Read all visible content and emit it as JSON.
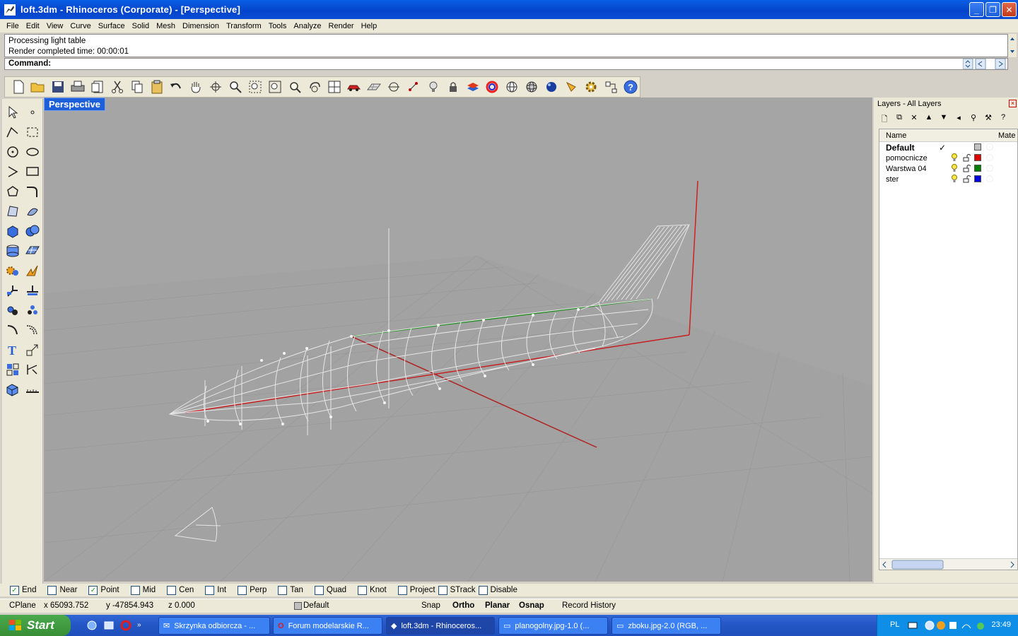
{
  "window": {
    "title": "loft.3dm - Rhinoceros (Corporate) - [Perspective]"
  },
  "menu": [
    "File",
    "Edit",
    "View",
    "Curve",
    "Surface",
    "Solid",
    "Mesh",
    "Dimension",
    "Transform",
    "Tools",
    "Analyze",
    "Render",
    "Help"
  ],
  "command_history": [
    "Processing light table",
    "Render completed time: 00:00:01"
  ],
  "command_prompt": "Command:",
  "viewport": {
    "label": "Perspective"
  },
  "layers_panel": {
    "title": "Layers - All Layers",
    "columns": {
      "name": "Name",
      "material": "Mate"
    },
    "layers": [
      {
        "name": "Default",
        "current": true,
        "color": "#c0c0c0"
      },
      {
        "name": "pomocnicze",
        "current": false,
        "color": "#e00000"
      },
      {
        "name": "Warstwa 04",
        "current": false,
        "color": "#008000"
      },
      {
        "name": "ster",
        "current": false,
        "color": "#0000e0"
      }
    ]
  },
  "osnap": [
    {
      "label": "End",
      "checked": true
    },
    {
      "label": "Near",
      "checked": false
    },
    {
      "label": "Point",
      "checked": true
    },
    {
      "label": "Mid",
      "checked": false
    },
    {
      "label": "Cen",
      "checked": false
    },
    {
      "label": "Int",
      "checked": false
    },
    {
      "label": "Perp",
      "checked": false
    },
    {
      "label": "Tan",
      "checked": false
    },
    {
      "label": "Quad",
      "checked": false
    },
    {
      "label": "Knot",
      "checked": false
    },
    {
      "label": "Project",
      "checked": false
    },
    {
      "label": "STrack",
      "checked": false
    },
    {
      "label": "Disable",
      "checked": false
    }
  ],
  "status": {
    "cplane": "CPlane",
    "x": "x 65093.752",
    "y": "y -47854.943",
    "z": "z 0.000",
    "layer": "Default",
    "snap": "Snap",
    "ortho": "Ortho",
    "planar": "Planar",
    "osnap": "Osnap",
    "record_history": "Record History"
  },
  "taskbar": {
    "start": "Start",
    "tasks": [
      "Skrzynka odbiorcza - ...",
      "Forum modelarskie R...",
      "loft.3dm - Rhinoceros...",
      "planogolny.jpg-1.0 (...",
      "zboku.jpg-2.0 (RGB, ..."
    ],
    "lang": "PL",
    "clock": "23:49"
  }
}
